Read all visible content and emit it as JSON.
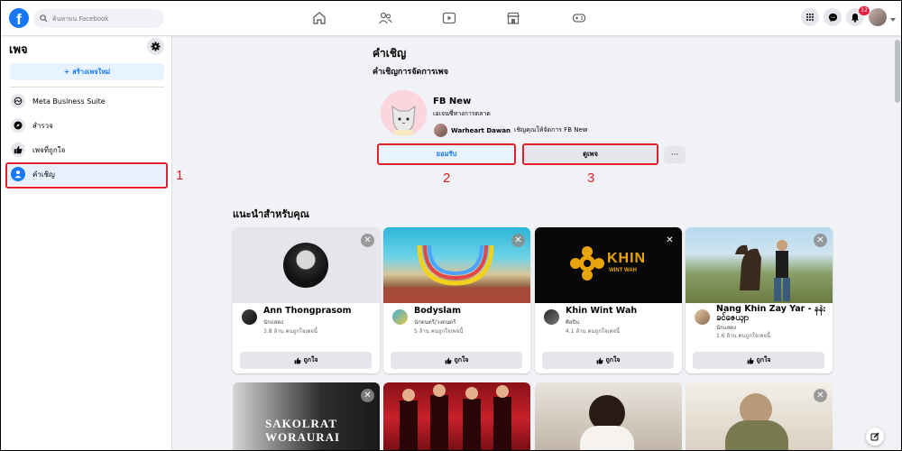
{
  "topbar": {
    "logo": "f",
    "search_placeholder": "ค้นหาบน Facebook",
    "nav_icons": [
      "home-icon",
      "friends-icon",
      "watch-icon",
      "marketplace-icon",
      "gaming-icon"
    ],
    "right_icons": [
      "menu-grid-icon",
      "messenger-icon",
      "notifications-icon",
      "account-avatar"
    ],
    "notification_count": "12"
  },
  "sidebar": {
    "title": "เพจ",
    "create_label": "สร้างเพจใหม่",
    "create_icon": "+",
    "items": [
      {
        "label": "Meta Business Suite",
        "icon": "meta-icon"
      },
      {
        "label": "สำรวจ",
        "icon": "compass-icon"
      },
      {
        "label": "เพจที่ถูกใจ",
        "icon": "thumbs-up-icon"
      },
      {
        "label": "คำเชิญ",
        "icon": "person-icon"
      }
    ]
  },
  "invitation": {
    "title": "คำเชิญ",
    "subtitle": "คำเชิญการจัดการเพจ",
    "page_name": "FB New",
    "page_category": "เอเจนซี่ทางการตลาด",
    "inviter_name": "Warheart Dawan",
    "inviter_text": "เชิญคุณให้จัดการ FB New",
    "accept_label": "ยอมรับ",
    "view_label": "ดูเพจ",
    "more_label": "···"
  },
  "annotations": [
    "1",
    "2",
    "3"
  ],
  "recommendations": {
    "title": "แนะนำสำหรับคุณ",
    "like_label": "ถูกใจ",
    "close_label": "✕",
    "cards": [
      {
        "name": "Ann Thongprasom",
        "category": "นักแสดง",
        "likes": "3.8 ล้าน คนถูกใจเพจนี้"
      },
      {
        "name": "Bodyslam",
        "category": "นักดนตรี/วงดนตรี",
        "likes": "5 ล้าน คนถูกใจเพจนี้"
      },
      {
        "name": "Khin Wint Wah",
        "category": "ศิลปิน",
        "likes": "4.1 ล้าน คนถูกใจเพจนี้"
      },
      {
        "name": "Nang Khin Zay Yar - နန်းခင်ဇေယျာ",
        "category": "นักแสดง",
        "likes": "1.6 ล้าน คนถูกใจเพจนี้"
      }
    ],
    "banner_text": {
      "khin_logo": "KHIN",
      "khin_sub": "WINT WAH",
      "sakolrat": "SAKOLRAT",
      "worarurai": "WORAURAI"
    }
  },
  "colors": {
    "brand": "#1877f2",
    "annotation_red": "#e0202c",
    "page_bg": "#f0f2f5"
  }
}
